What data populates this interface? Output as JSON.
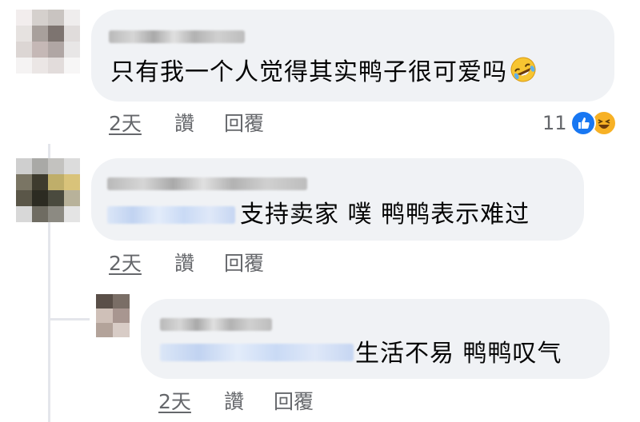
{
  "comments": [
    {
      "author": "",
      "text": "只有我一个人觉得其实鸭子很可爱吗",
      "emoji": "rofl-emoji",
      "actions": {
        "time": "2天",
        "like": "讚",
        "reply": "回覆"
      },
      "reactions": {
        "count": "11",
        "icons": [
          "like-icon",
          "haha-icon"
        ]
      }
    },
    {
      "author": "",
      "text": "支持卖家 噗 鸭鸭表示难过",
      "actions": {
        "time": "2天",
        "like": "讚",
        "reply": "回覆"
      }
    },
    {
      "author": "",
      "text": "生活不易 鸭鸭叹气",
      "actions": {
        "time": "2天",
        "like": "讚",
        "reply": "回覆"
      }
    }
  ],
  "colors": {
    "bubble": "#f0f2f5",
    "meta_text": "#65676b",
    "like_blue": "#1877f2",
    "haha_yellow": "#f7b125"
  }
}
